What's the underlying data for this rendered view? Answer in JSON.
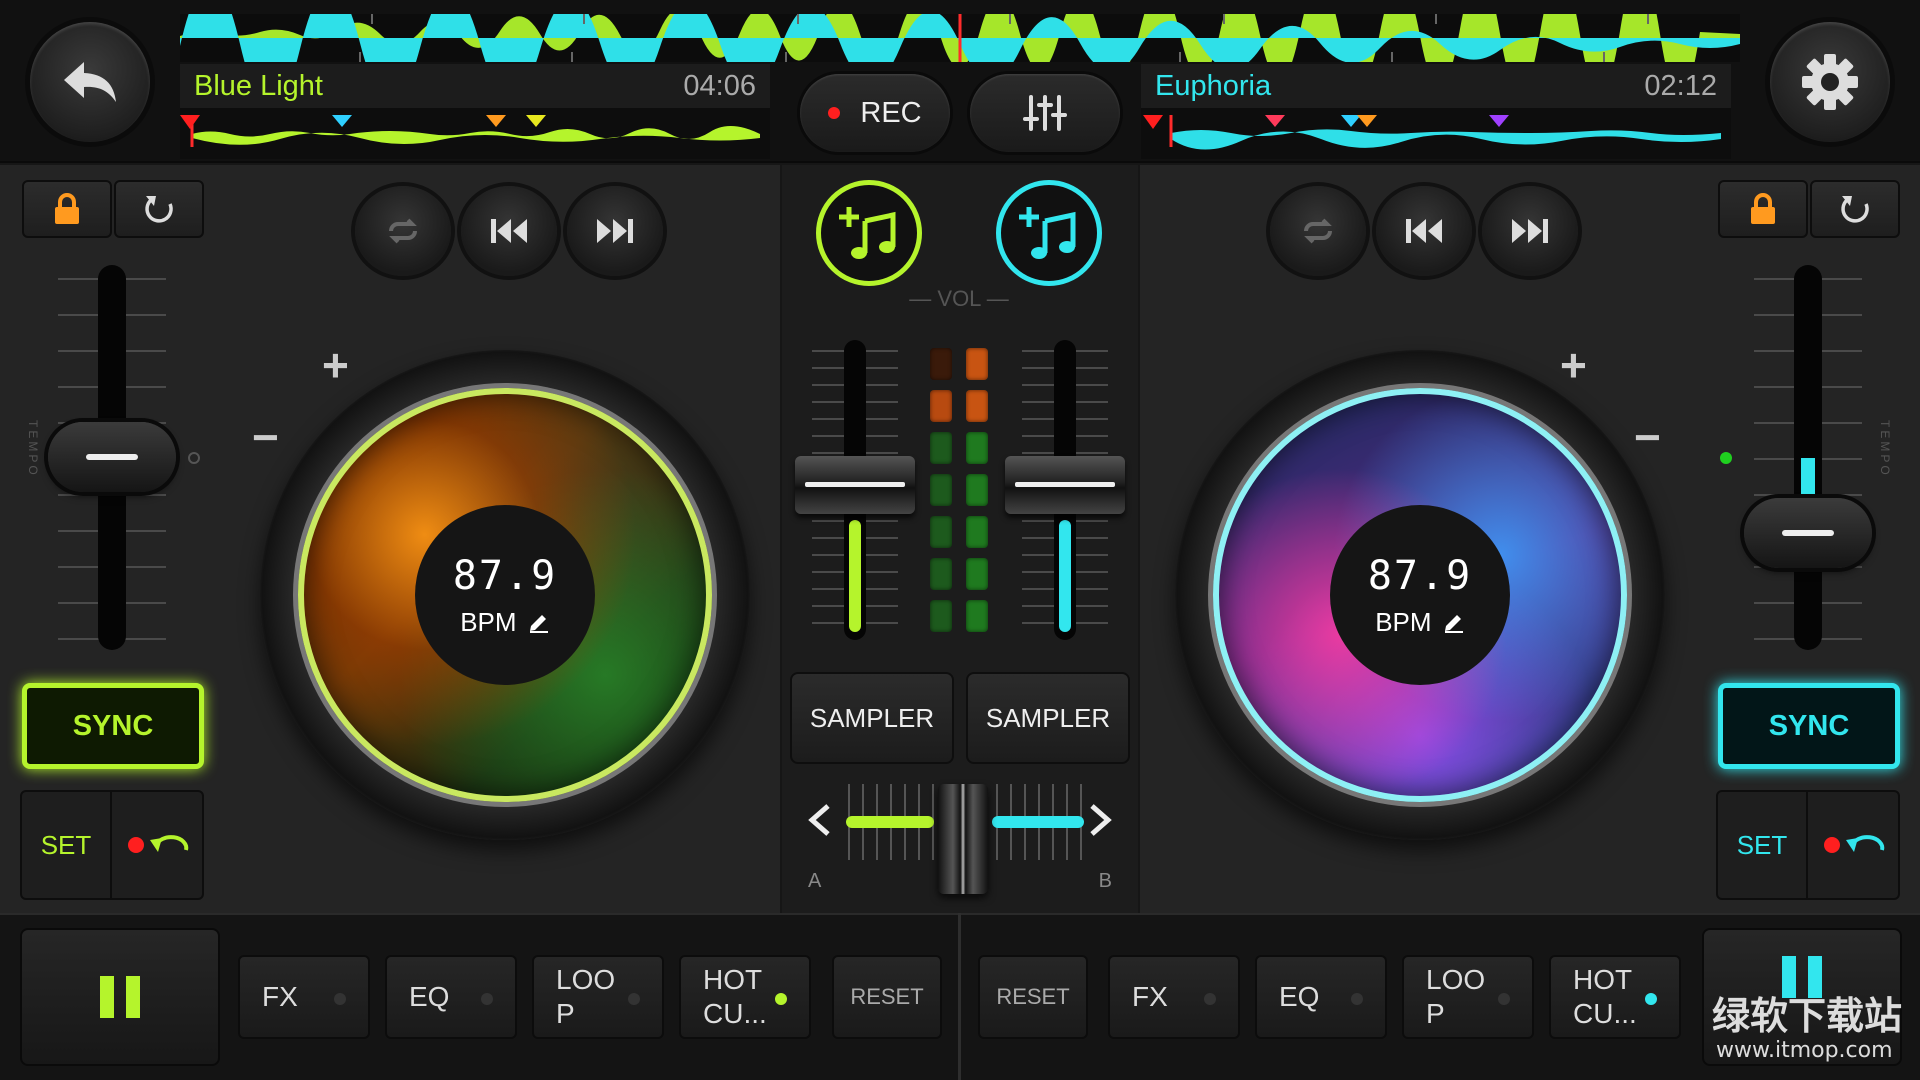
{
  "top": {
    "back_icon": "undo-arrow-icon",
    "settings_icon": "gear-icon",
    "rec_label": "REC",
    "mixer_icon": "sliders-icon"
  },
  "deck_a": {
    "title": "Blue Light",
    "time": "04:06",
    "bpm": "87.9",
    "bpm_label": "BPM",
    "sync_label": "SYNC",
    "set_label": "SET",
    "tempo_label": "TEMPO",
    "accent": "#b5f42c",
    "plus": "+",
    "minus": "−"
  },
  "deck_b": {
    "title": "Euphoria",
    "time": "02:12",
    "bpm": "87.9",
    "bpm_label": "BPM",
    "sync_label": "SYNC",
    "set_label": "SET",
    "tempo_label": "TEMPO",
    "accent": "#32e6ee",
    "plus": "+",
    "minus": "−"
  },
  "mixer": {
    "vol_label": "VOL",
    "sampler_a": "SAMPLER",
    "sampler_b": "SAMPLER",
    "crossfader_a": "A",
    "crossfader_b": "B"
  },
  "bottom_a": {
    "fx": "FX",
    "eq": "EQ",
    "loop": "LOO\nP",
    "hotcue": "HOT\nCU...",
    "reset": "RESET"
  },
  "bottom_b": {
    "fx": "FX",
    "eq": "EQ",
    "loop": "LOO\nP",
    "hotcue": "HOT\nCU...",
    "reset": "RESET"
  },
  "watermark": {
    "cn": "绿软下载站",
    "url": "www.itmop.com"
  }
}
